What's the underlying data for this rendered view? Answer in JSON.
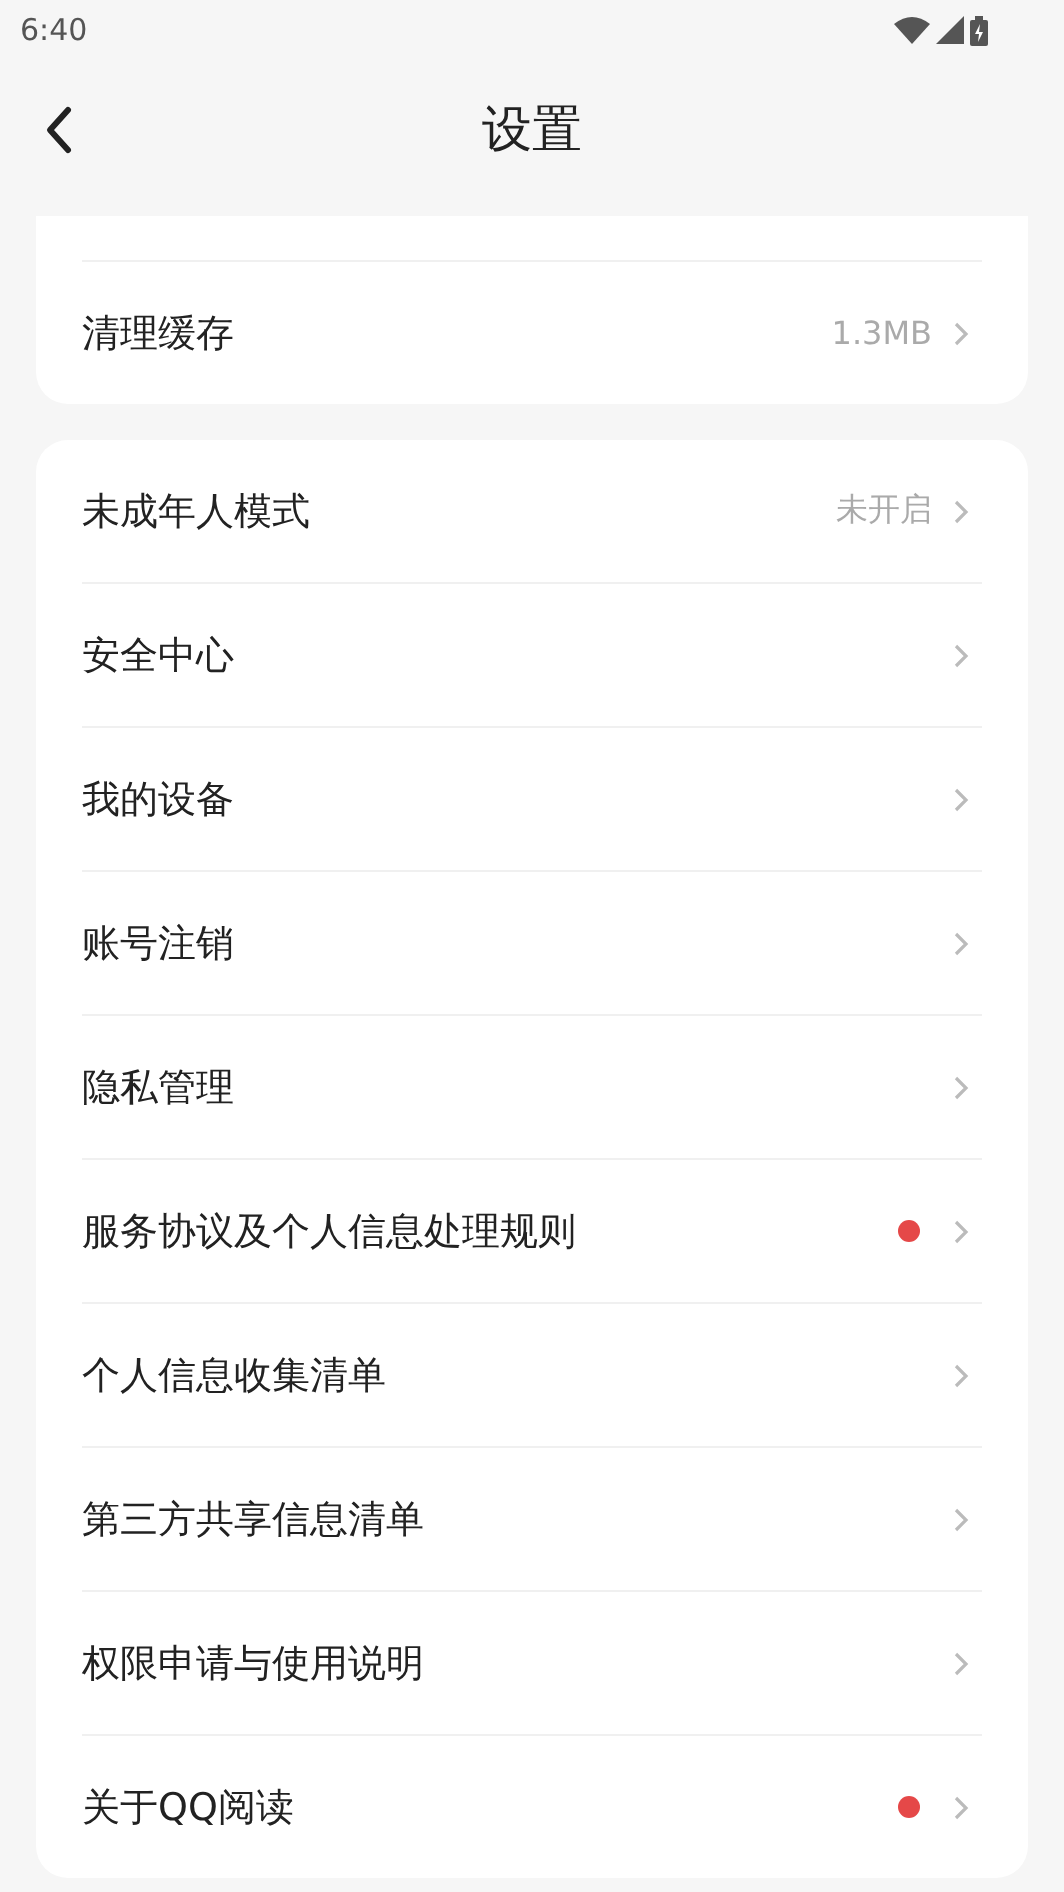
{
  "status_bar": {
    "time": "6:40"
  },
  "header": {
    "title": "设置"
  },
  "groups": [
    {
      "clipped_top": true,
      "items": [
        {
          "label": "清理缓存",
          "value": "1.3MB",
          "dot": false
        }
      ]
    },
    {
      "clipped_top": false,
      "items": [
        {
          "label": "未成年人模式",
          "value": "未开启",
          "dot": false
        },
        {
          "label": "安全中心",
          "dot": false
        },
        {
          "label": "我的设备",
          "dot": false
        },
        {
          "label": "账号注销",
          "dot": false
        },
        {
          "label": "隐私管理",
          "dot": false
        },
        {
          "label": "服务协议及个人信息处理规则",
          "dot": true
        },
        {
          "label": "个人信息收集清单",
          "dot": false
        },
        {
          "label": "第三方共享信息清单",
          "dot": false
        },
        {
          "label": "权限申请与使用说明",
          "dot": false
        },
        {
          "label": "关于QQ阅读",
          "dot": true
        }
      ]
    }
  ]
}
